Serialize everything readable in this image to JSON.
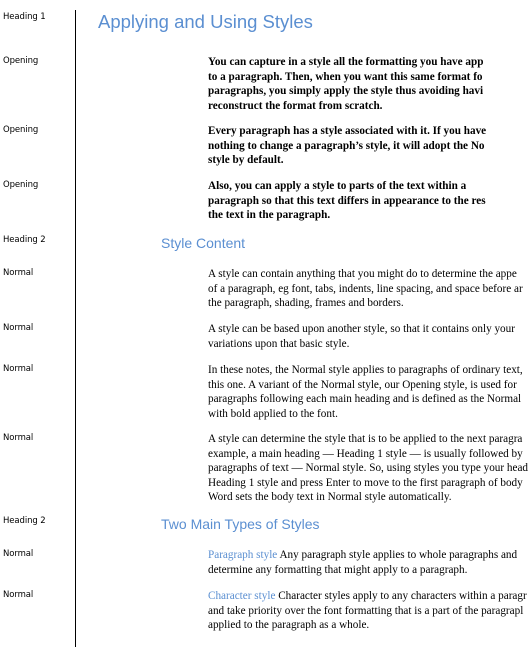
{
  "style_area": {
    "labels": [
      "Heading 1",
      "Opening",
      "Opening",
      "Opening",
      "Heading 2",
      "Normal",
      "Normal",
      "Normal",
      "Normal",
      "Heading 2",
      "Normal",
      "Normal"
    ]
  },
  "colors": {
    "heading": "#5b8fd1",
    "text": "#000000",
    "divider": "#000000"
  },
  "document": {
    "heading1": "Applying and Using Styles",
    "opening_paragraphs": [
      {
        "lines": [
          "You can capture in a style all the formatting you have app",
          "to a paragraph. Then, when you want this same format fo",
          "paragraphs, you simply apply the style thus avoiding havi",
          "reconstruct the format from scratch."
        ]
      },
      {
        "lines": [
          "Every paragraph has a style associated with it. If you have",
          "nothing to change a paragraph’s style, it will adopt the No",
          "style by default."
        ]
      },
      {
        "lines": [
          "Also, you can apply a style to parts of the text within a",
          "paragraph so that this text differs in appearance to the res",
          "the text in the paragraph."
        ]
      }
    ],
    "section1": {
      "heading": "Style Content",
      "paragraphs": [
        {
          "lines": [
            "A style can contain anything that you might do to determine the appe",
            "of a paragraph, eg font, tabs, indents, line spacing, and space before ar",
            "the paragraph, shading, frames and borders."
          ]
        },
        {
          "lines": [
            "A style can be based upon another style, so that it contains only your",
            "variations upon that basic style."
          ]
        },
        {
          "lines": [
            "In these notes, the Normal style applies to paragraphs of ordinary text,",
            "this one. A variant of the Normal style, our Opening style, is used for",
            "paragraphs following each main heading and is defined as the Normal",
            "with bold applied to the font."
          ]
        },
        {
          "lines": [
            "A style can determine the style that is to be applied to the next paragra",
            "example, a main heading — Heading 1 style — is usually followed by",
            "paragraphs of text — Normal style. So, using styles you type your head",
            "Heading 1 style and press Enter to move to the first paragraph of body",
            "Word sets the body text in Normal style automatically."
          ]
        }
      ]
    },
    "section2": {
      "heading": "Two Main Types of Styles",
      "paragraphs": [
        {
          "lead": "Paragraph style",
          "first_line_rest": " Any paragraph style applies to whole paragraphs and",
          "lines": [
            "determine any formatting that might apply to a paragraph."
          ]
        },
        {
          "lead": "Character style",
          "first_line_rest": " Character styles apply to any characters within a paragr",
          "lines": [
            "and take priority over the font formatting that is a part of the paragrapl",
            "applied to the paragraph as a whole."
          ]
        }
      ]
    }
  }
}
